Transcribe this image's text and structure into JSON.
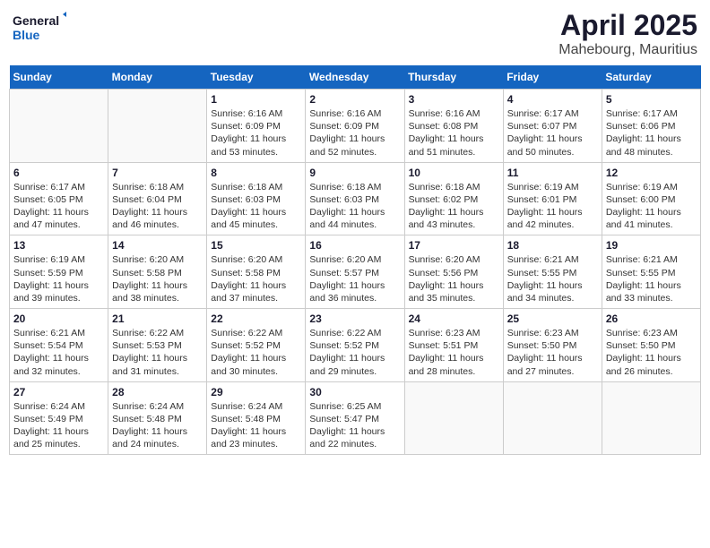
{
  "logo": {
    "line1": "General",
    "line2": "Blue"
  },
  "title": "April 2025",
  "subtitle": "Mahebourg, Mauritius",
  "days_header": [
    "Sunday",
    "Monday",
    "Tuesday",
    "Wednesday",
    "Thursday",
    "Friday",
    "Saturday"
  ],
  "weeks": [
    [
      {
        "num": "",
        "info": ""
      },
      {
        "num": "",
        "info": ""
      },
      {
        "num": "1",
        "info": "Sunrise: 6:16 AM\nSunset: 6:09 PM\nDaylight: 11 hours and 53 minutes."
      },
      {
        "num": "2",
        "info": "Sunrise: 6:16 AM\nSunset: 6:09 PM\nDaylight: 11 hours and 52 minutes."
      },
      {
        "num": "3",
        "info": "Sunrise: 6:16 AM\nSunset: 6:08 PM\nDaylight: 11 hours and 51 minutes."
      },
      {
        "num": "4",
        "info": "Sunrise: 6:17 AM\nSunset: 6:07 PM\nDaylight: 11 hours and 50 minutes."
      },
      {
        "num": "5",
        "info": "Sunrise: 6:17 AM\nSunset: 6:06 PM\nDaylight: 11 hours and 48 minutes."
      }
    ],
    [
      {
        "num": "6",
        "info": "Sunrise: 6:17 AM\nSunset: 6:05 PM\nDaylight: 11 hours and 47 minutes."
      },
      {
        "num": "7",
        "info": "Sunrise: 6:18 AM\nSunset: 6:04 PM\nDaylight: 11 hours and 46 minutes."
      },
      {
        "num": "8",
        "info": "Sunrise: 6:18 AM\nSunset: 6:03 PM\nDaylight: 11 hours and 45 minutes."
      },
      {
        "num": "9",
        "info": "Sunrise: 6:18 AM\nSunset: 6:03 PM\nDaylight: 11 hours and 44 minutes."
      },
      {
        "num": "10",
        "info": "Sunrise: 6:18 AM\nSunset: 6:02 PM\nDaylight: 11 hours and 43 minutes."
      },
      {
        "num": "11",
        "info": "Sunrise: 6:19 AM\nSunset: 6:01 PM\nDaylight: 11 hours and 42 minutes."
      },
      {
        "num": "12",
        "info": "Sunrise: 6:19 AM\nSunset: 6:00 PM\nDaylight: 11 hours and 41 minutes."
      }
    ],
    [
      {
        "num": "13",
        "info": "Sunrise: 6:19 AM\nSunset: 5:59 PM\nDaylight: 11 hours and 39 minutes."
      },
      {
        "num": "14",
        "info": "Sunrise: 6:20 AM\nSunset: 5:58 PM\nDaylight: 11 hours and 38 minutes."
      },
      {
        "num": "15",
        "info": "Sunrise: 6:20 AM\nSunset: 5:58 PM\nDaylight: 11 hours and 37 minutes."
      },
      {
        "num": "16",
        "info": "Sunrise: 6:20 AM\nSunset: 5:57 PM\nDaylight: 11 hours and 36 minutes."
      },
      {
        "num": "17",
        "info": "Sunrise: 6:20 AM\nSunset: 5:56 PM\nDaylight: 11 hours and 35 minutes."
      },
      {
        "num": "18",
        "info": "Sunrise: 6:21 AM\nSunset: 5:55 PM\nDaylight: 11 hours and 34 minutes."
      },
      {
        "num": "19",
        "info": "Sunrise: 6:21 AM\nSunset: 5:55 PM\nDaylight: 11 hours and 33 minutes."
      }
    ],
    [
      {
        "num": "20",
        "info": "Sunrise: 6:21 AM\nSunset: 5:54 PM\nDaylight: 11 hours and 32 minutes."
      },
      {
        "num": "21",
        "info": "Sunrise: 6:22 AM\nSunset: 5:53 PM\nDaylight: 11 hours and 31 minutes."
      },
      {
        "num": "22",
        "info": "Sunrise: 6:22 AM\nSunset: 5:52 PM\nDaylight: 11 hours and 30 minutes."
      },
      {
        "num": "23",
        "info": "Sunrise: 6:22 AM\nSunset: 5:52 PM\nDaylight: 11 hours and 29 minutes."
      },
      {
        "num": "24",
        "info": "Sunrise: 6:23 AM\nSunset: 5:51 PM\nDaylight: 11 hours and 28 minutes."
      },
      {
        "num": "25",
        "info": "Sunrise: 6:23 AM\nSunset: 5:50 PM\nDaylight: 11 hours and 27 minutes."
      },
      {
        "num": "26",
        "info": "Sunrise: 6:23 AM\nSunset: 5:50 PM\nDaylight: 11 hours and 26 minutes."
      }
    ],
    [
      {
        "num": "27",
        "info": "Sunrise: 6:24 AM\nSunset: 5:49 PM\nDaylight: 11 hours and 25 minutes."
      },
      {
        "num": "28",
        "info": "Sunrise: 6:24 AM\nSunset: 5:48 PM\nDaylight: 11 hours and 24 minutes."
      },
      {
        "num": "29",
        "info": "Sunrise: 6:24 AM\nSunset: 5:48 PM\nDaylight: 11 hours and 23 minutes."
      },
      {
        "num": "30",
        "info": "Sunrise: 6:25 AM\nSunset: 5:47 PM\nDaylight: 11 hours and 22 minutes."
      },
      {
        "num": "",
        "info": ""
      },
      {
        "num": "",
        "info": ""
      },
      {
        "num": "",
        "info": ""
      }
    ]
  ]
}
